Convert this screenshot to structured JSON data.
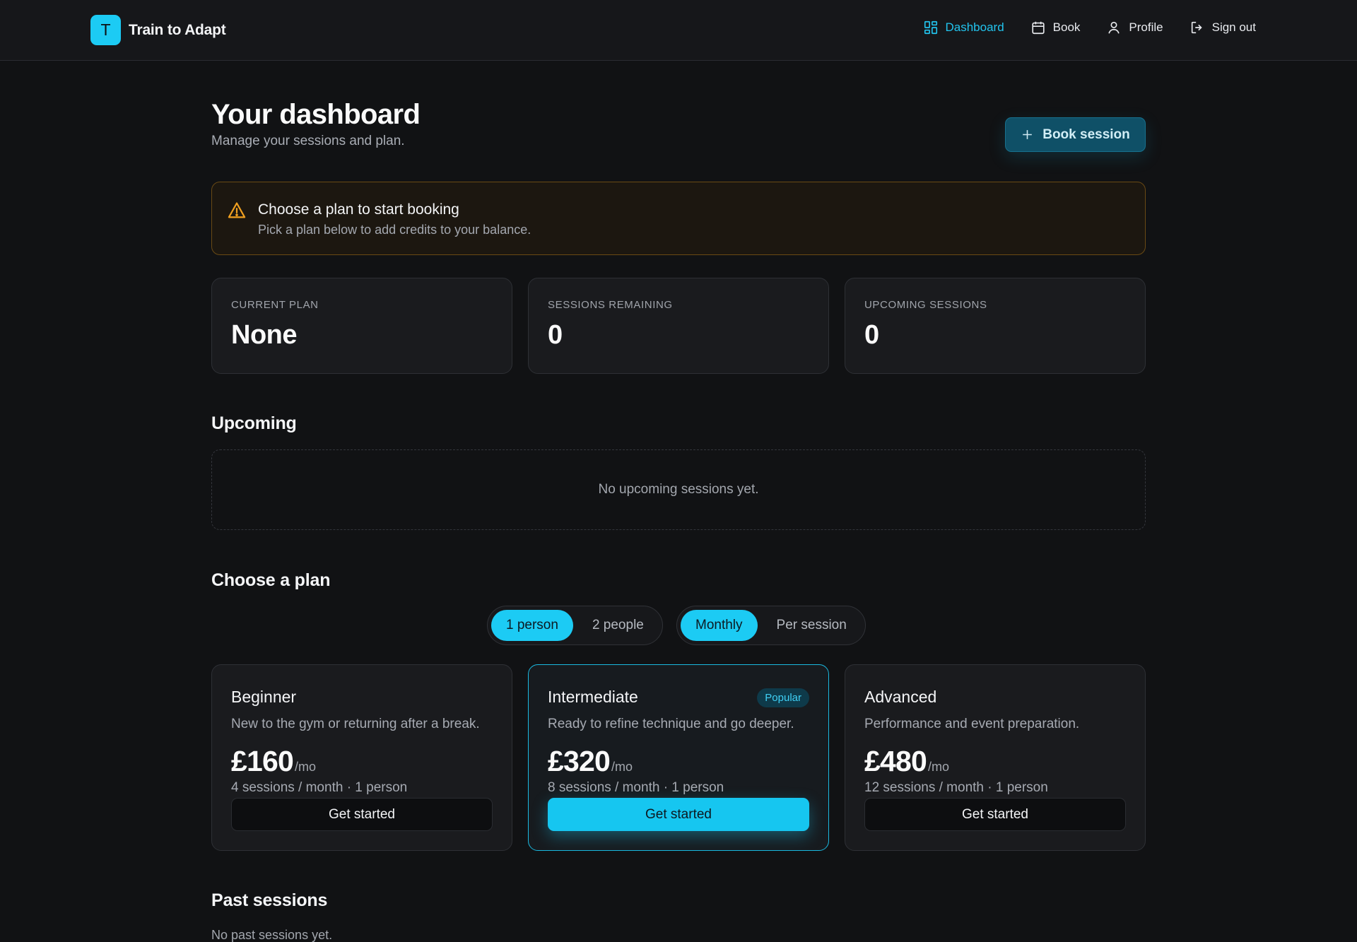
{
  "brand": {
    "initial": "T",
    "name": "Train to Adapt"
  },
  "nav": {
    "dashboard": "Dashboard",
    "book": "Book",
    "profile": "Profile",
    "sign_out": "Sign out"
  },
  "page": {
    "title": "Your dashboard",
    "subtitle": "Manage your sessions and plan.",
    "book_button": "Book session"
  },
  "alert": {
    "title": "Choose a plan to start booking",
    "text": "Pick a plan below to add credits to your balance."
  },
  "stats": [
    {
      "label": "CURRENT PLAN",
      "value": "None"
    },
    {
      "label": "SESSIONS REMAINING",
      "value": "0"
    },
    {
      "label": "UPCOMING SESSIONS",
      "value": "0"
    }
  ],
  "upcoming": {
    "title": "Upcoming",
    "empty": "No upcoming sessions yet."
  },
  "plans_section": {
    "title": "Choose a plan",
    "people_toggle": {
      "options": [
        "1 person",
        "2 people"
      ],
      "selected": "1 person"
    },
    "billing_toggle": {
      "options": [
        "Monthly",
        "Per session"
      ],
      "selected": "Monthly"
    }
  },
  "plans": [
    {
      "name": "Beginner",
      "description": "New to the gym or returning after a break.",
      "price": "£160",
      "period": "/mo",
      "meta": "4 sessions / month · 1 person",
      "cta": "Get started"
    },
    {
      "name": "Intermediate",
      "badge": "Popular",
      "description": "Ready to refine technique and go deeper.",
      "price": "£320",
      "period": "/mo",
      "meta": "8 sessions / month · 1 person",
      "cta": "Get started"
    },
    {
      "name": "Advanced",
      "description": "Performance and event preparation.",
      "price": "£480",
      "period": "/mo",
      "meta": "12 sessions / month · 1 person",
      "cta": "Get started"
    }
  ],
  "past": {
    "title": "Past sessions",
    "empty": "No past sessions yet."
  },
  "icons": {
    "dashboard": "grid-icon",
    "book": "calendar-icon",
    "profile": "user-icon",
    "sign_out": "sign-out-icon",
    "book_session": "plus-icon",
    "alert": "warning-triangle-icon"
  },
  "colors": {
    "accent": "#1ccbf4",
    "background": "#111214",
    "card": "#1a1b1e",
    "warning": "#f0a020"
  }
}
